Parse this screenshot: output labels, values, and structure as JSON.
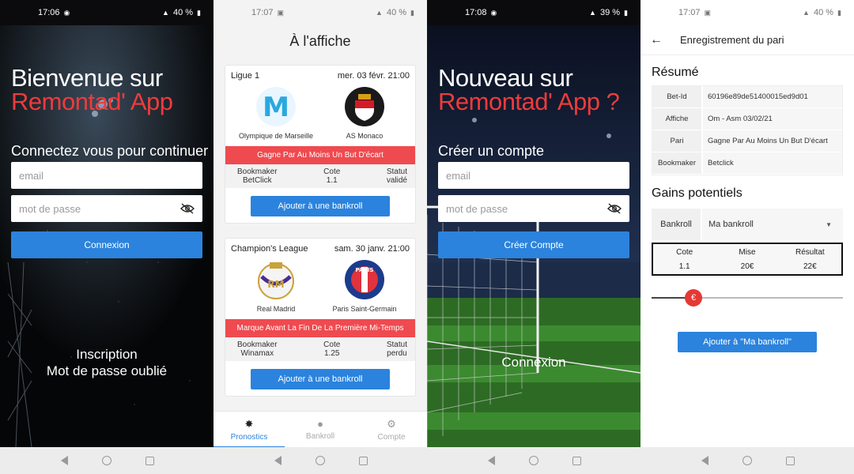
{
  "screen1": {
    "status": {
      "time": "17:06",
      "battery": "40 %"
    },
    "title_line1": "Bienvenue sur",
    "title_line2": "Remontad' App",
    "subtitle": "Connectez vous pour continuer",
    "email_placeholder": "email",
    "password_placeholder": "mot de passe",
    "login_button": "Connexion",
    "register_link": "Inscription",
    "forgot_link": "Mot de passe oublié"
  },
  "screen2": {
    "status": {
      "time": "17:07",
      "battery": "40 %"
    },
    "title": "À l'affiche",
    "cards": [
      {
        "league": "Ligue 1",
        "date": "mer. 03 févr. 21:00",
        "home": "Olympique de Marseille",
        "away": "AS Monaco",
        "prediction": "Gagne Par Au Moins Un But D'écart",
        "bookmaker_label": "Bookmaker",
        "bookmaker": "BetClick",
        "cote_label": "Cote",
        "cote": "1.1",
        "statut_label": "Statut",
        "statut": "validé",
        "button": "Ajouter à une bankroll"
      },
      {
        "league": "Champion's League",
        "date": "sam. 30 janv. 21:00",
        "home": "Real Madrid",
        "away": "Paris Saint-Germain",
        "prediction": "Marque Avant La Fin De La Première Mi-Temps",
        "bookmaker_label": "Bookmaker",
        "bookmaker": "Winamax",
        "cote_label": "Cote",
        "cote": "1.25",
        "statut_label": "Statut",
        "statut": "perdu",
        "button": "Ajouter à une bankroll"
      }
    ],
    "tabs": [
      "Pronostics",
      "Bankroll",
      "Compte"
    ]
  },
  "screen3": {
    "status": {
      "time": "17:08",
      "battery": "39 %"
    },
    "title_line1": "Nouveau sur",
    "title_line2": "Remontad' App ?",
    "subtitle": "Créer un compte",
    "email_placeholder": "email",
    "password_placeholder": "mot de passe",
    "create_button": "Créer Compte",
    "login_link": "Connexion"
  },
  "screen4": {
    "status": {
      "time": "17:07",
      "battery": "40 %"
    },
    "appbar_title": "Enregistrement du pari",
    "summary_title": "Résumé",
    "rows": [
      {
        "key": "Bet-Id",
        "value": "60196e89de51400015ed9d01"
      },
      {
        "key": "Affiche",
        "value": "Om - Asm 03/02/21"
      },
      {
        "key": "Pari",
        "value": "Gagne Par Au Moins Un But D'écart"
      },
      {
        "key": "Bookmaker",
        "value": "Betclick"
      }
    ],
    "gains_title": "Gains potentiels",
    "bankroll_label": "Bankroll",
    "bankroll_value": "Ma bankroll",
    "cote_label": "Cote",
    "cote": "1.1",
    "mise_label": "Mise",
    "mise": "20€",
    "resultat_label": "Résultat",
    "resultat": "22€",
    "slider_value": 0.22,
    "slider_thumb": "€",
    "add_button": "Ajouter à \"Ma bankroll\""
  },
  "colors": {
    "accent": "#2b83dd",
    "red": "#ef4a4f",
    "brand_red": "#ef3b3b"
  }
}
